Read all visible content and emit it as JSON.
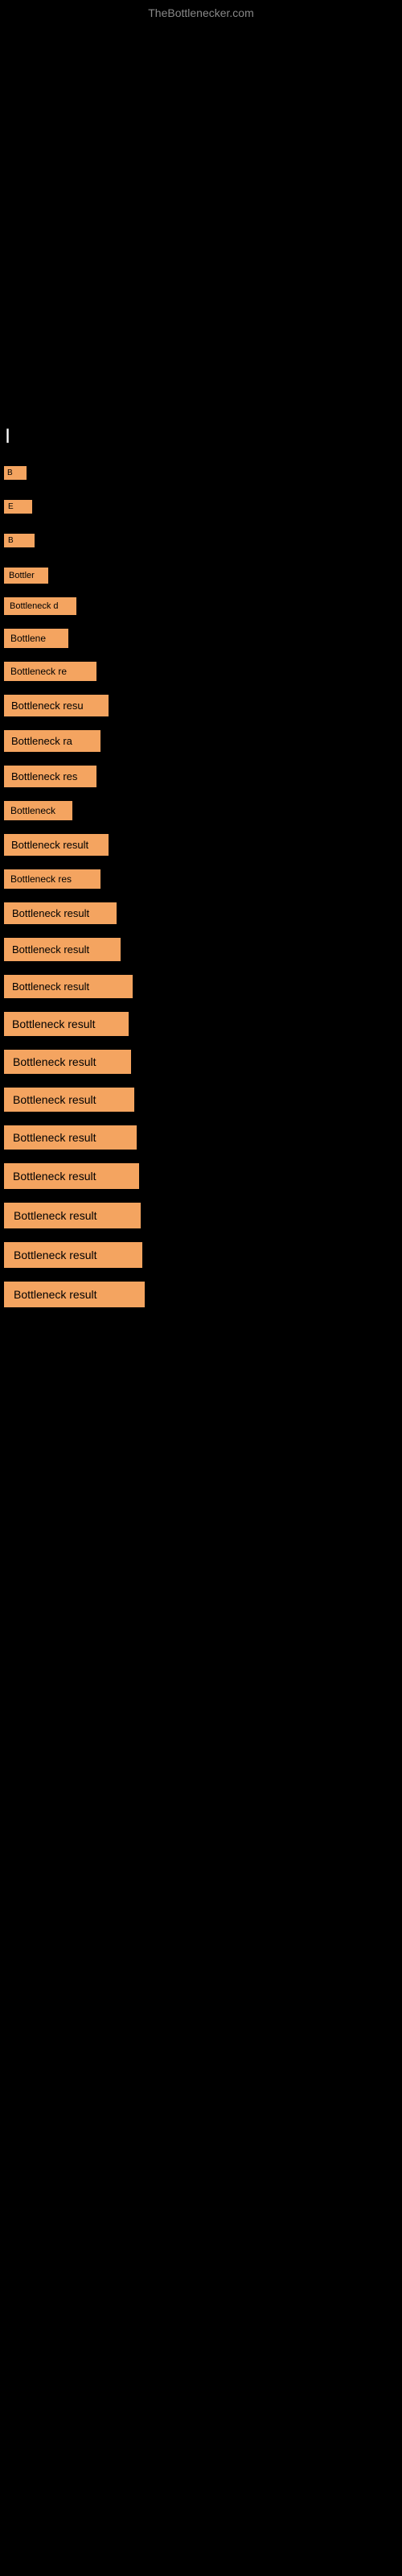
{
  "site": {
    "title": "TheBottlenecker.com"
  },
  "header": {
    "label": "|"
  },
  "results": [
    {
      "id": 1,
      "text": "B",
      "size_class": "size-1"
    },
    {
      "id": 2,
      "text": "E",
      "size_class": "size-2"
    },
    {
      "id": 3,
      "text": "B",
      "size_class": "size-3"
    },
    {
      "id": 4,
      "text": "Bottler",
      "size_class": "size-4"
    },
    {
      "id": 5,
      "text": "Bottleneck d",
      "size_class": "size-5"
    },
    {
      "id": 6,
      "text": "Bottlene",
      "size_class": "size-6"
    },
    {
      "id": 7,
      "text": "Bottleneck re",
      "size_class": "size-7"
    },
    {
      "id": 8,
      "text": "Bottleneck resu",
      "size_class": "size-8"
    },
    {
      "id": 9,
      "text": "Bottleneck ra",
      "size_class": "size-9"
    },
    {
      "id": 10,
      "text": "Bottleneck res",
      "size_class": "size-10"
    },
    {
      "id": 11,
      "text": "Bottleneck",
      "size_class": "size-11"
    },
    {
      "id": 12,
      "text": "Bottleneck result",
      "size_class": "size-12"
    },
    {
      "id": 13,
      "text": "Bottleneck res",
      "size_class": "size-13"
    },
    {
      "id": 14,
      "text": "Bottleneck result",
      "size_class": "size-14"
    },
    {
      "id": 15,
      "text": "Bottleneck result",
      "size_class": "size-15"
    },
    {
      "id": 16,
      "text": "Bottleneck result",
      "size_class": "size-16"
    },
    {
      "id": 17,
      "text": "Bottleneck result",
      "size_class": "size-17"
    },
    {
      "id": 18,
      "text": "Bottleneck result",
      "size_class": "size-18"
    },
    {
      "id": 19,
      "text": "Bottleneck result",
      "size_class": "size-19"
    },
    {
      "id": 20,
      "text": "Bottleneck result",
      "size_class": "size-20"
    },
    {
      "id": 21,
      "text": "Bottleneck result",
      "size_class": "size-21"
    },
    {
      "id": 22,
      "text": "Bottleneck result",
      "size_class": "size-22"
    },
    {
      "id": 23,
      "text": "Bottleneck result",
      "size_class": "size-23"
    },
    {
      "id": 24,
      "text": "Bottleneck result",
      "size_class": "size-24"
    }
  ],
  "colors": {
    "background": "#000000",
    "orange": "#F4A460",
    "text_light": "#888888",
    "text_white": "#ffffff"
  }
}
